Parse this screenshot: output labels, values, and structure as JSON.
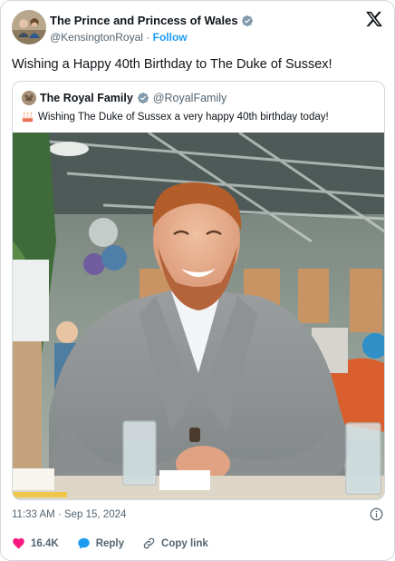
{
  "header": {
    "display_name": "The Prince and Princess of Wales",
    "handle": "@KensingtonRoyal",
    "separator": "·",
    "follow_label": "Follow",
    "verified_icon": "verified-badge-icon",
    "logo_icon": "x-logo-icon"
  },
  "tweet": {
    "text": "Wishing a Happy 40th Birthday to The Duke of Sussex!"
  },
  "quote": {
    "display_name": "The Royal Family",
    "handle": "@RoyalFamily",
    "text": "Wishing The Duke of Sussex a very happy 40th birthday today!",
    "emoji_icon": "birthday-cake-icon"
  },
  "meta": {
    "timestamp": "11:33 AM · Sep 15, 2024"
  },
  "actions": {
    "likes": "16.4K",
    "reply_label": "Reply",
    "copy_label": "Copy link"
  },
  "colors": {
    "accent": "#1d9bf0",
    "like": "#f91880",
    "text": "#0f1419",
    "muted": "#536471",
    "border": "#cfd9de"
  }
}
